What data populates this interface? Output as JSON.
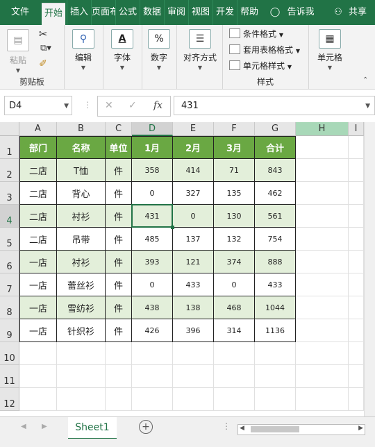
{
  "ribbon_tabs": [
    "文件",
    "开始",
    "插入",
    "页面布局",
    "公式",
    "数据",
    "审阅",
    "视图",
    "开发",
    "帮助",
    "告诉我",
    "共享"
  ],
  "ribbon": {
    "paste_label": "粘贴",
    "clipboard_group": "剪贴板",
    "edit_label": "编辑",
    "font_label": "字体",
    "number_label": "数字",
    "align_label": "对齐方式",
    "cond_format": "条件格式",
    "table_format": "套用表格格式",
    "cell_style": "单元格样式",
    "styles_group": "样式",
    "cells_label": "单元格"
  },
  "formula_bar": {
    "name_box": "D4",
    "fx": "fx",
    "formula": "431"
  },
  "columns": [
    "A",
    "B",
    "C",
    "D",
    "E",
    "F",
    "G",
    "H",
    "I"
  ],
  "rows": [
    "1",
    "2",
    "3",
    "4",
    "5",
    "6",
    "7",
    "8",
    "9",
    "10",
    "11",
    "12"
  ],
  "table": {
    "headers": [
      "部门",
      "名称",
      "单位",
      "1月",
      "2月",
      "3月",
      "合计"
    ],
    "rows": [
      [
        "二店",
        "T恤",
        "件",
        "358",
        "414",
        "71",
        "843"
      ],
      [
        "二店",
        "背心",
        "件",
        "0",
        "327",
        "135",
        "462"
      ],
      [
        "二店",
        "衬衫",
        "件",
        "431",
        "0",
        "130",
        "561"
      ],
      [
        "二店",
        "吊带",
        "件",
        "485",
        "137",
        "132",
        "754"
      ],
      [
        "一店",
        "衬衫",
        "件",
        "393",
        "121",
        "374",
        "888"
      ],
      [
        "一店",
        "蕾丝衫",
        "件",
        "0",
        "433",
        "0",
        "433"
      ],
      [
        "一店",
        "雪纺衫",
        "件",
        "438",
        "138",
        "468",
        "1044"
      ],
      [
        "一店",
        "针织衫",
        "件",
        "426",
        "396",
        "314",
        "1136"
      ]
    ]
  },
  "sheet_tabs": [
    "Sheet1"
  ],
  "colors": {
    "brand": "#217346",
    "header_fill": "#6aa843",
    "alt_fill": "#e3efda"
  }
}
